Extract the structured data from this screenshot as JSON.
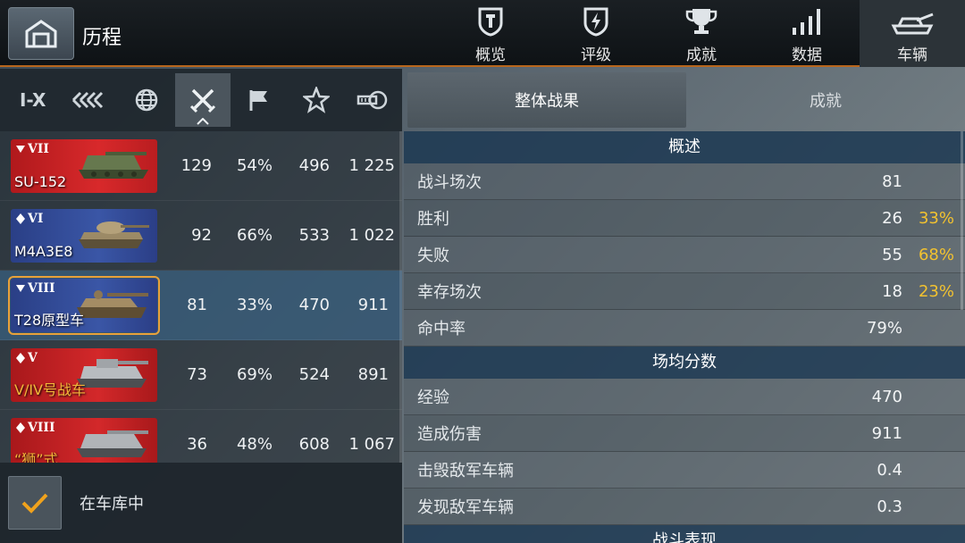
{
  "header": {
    "title": "历程",
    "tabs": [
      {
        "label": "概览",
        "icon": "shield-bolt-icon"
      },
      {
        "label": "评级",
        "icon": "rating-shield-icon"
      },
      {
        "label": "成就",
        "icon": "trophy-icon"
      },
      {
        "label": "数据",
        "icon": "bar-chart-icon"
      },
      {
        "label": "车辆",
        "icon": "tank-icon"
      }
    ],
    "active_tab": "车辆"
  },
  "filters": {
    "tier_label": "I-X",
    "items": [
      "tier-filter",
      "nation-filter",
      "globe-icon",
      "crossed-swords-icon",
      "flag-icon",
      "star-icon",
      "gun-icon"
    ],
    "active": "crossed-swords-icon"
  },
  "vehicles": [
    {
      "tier": "VII",
      "name": "SU-152",
      "nation": "ussr",
      "battles": "129",
      "winrate": "54%",
      "exp": "496",
      "damage": "1 225"
    },
    {
      "tier": "VI",
      "name": "M4A3E8",
      "nation": "usa",
      "battles": "92",
      "winrate": "66%",
      "exp": "533",
      "damage": "1 022"
    },
    {
      "tier": "VIII",
      "name": "T28原型车",
      "nation": "usa",
      "battles": "81",
      "winrate": "33%",
      "exp": "470",
      "damage": "911"
    },
    {
      "tier": "V",
      "name": "V/IV号战车",
      "nation": "ger",
      "battles": "73",
      "winrate": "69%",
      "exp": "524",
      "damage": "891"
    },
    {
      "tier": "VIII",
      "name": "“狮”式",
      "nation": "ger",
      "battles": "36",
      "winrate": "48%",
      "exp": "608",
      "damage": "1 067"
    }
  ],
  "garage_filter": {
    "label": "在车库中",
    "checked": true
  },
  "stat_tabs": {
    "overall": "整体战果",
    "achievements": "成就"
  },
  "sections": [
    {
      "title": "概述",
      "rows": [
        {
          "label": "战斗场次",
          "value": "81",
          "pct": ""
        },
        {
          "label": "胜利",
          "value": "26",
          "pct": "33%"
        },
        {
          "label": "失败",
          "value": "55",
          "pct": "68%"
        },
        {
          "label": "幸存场次",
          "value": "18",
          "pct": "23%"
        },
        {
          "label": "命中率",
          "value": "79%",
          "pct": ""
        }
      ]
    },
    {
      "title": "场均分数",
      "rows": [
        {
          "label": "经验",
          "value": "470",
          "pct": ""
        },
        {
          "label": "造成伤害",
          "value": "911",
          "pct": ""
        },
        {
          "label": "击毁敌军车辆",
          "value": "0.4",
          "pct": ""
        },
        {
          "label": "发现敌军车辆",
          "value": "0.3",
          "pct": ""
        }
      ]
    },
    {
      "title": "战斗表现",
      "rows": []
    }
  ],
  "colors": {
    "accent": "#b8661c",
    "pct": "#f2c230",
    "selected_row": "#3c6e96"
  }
}
